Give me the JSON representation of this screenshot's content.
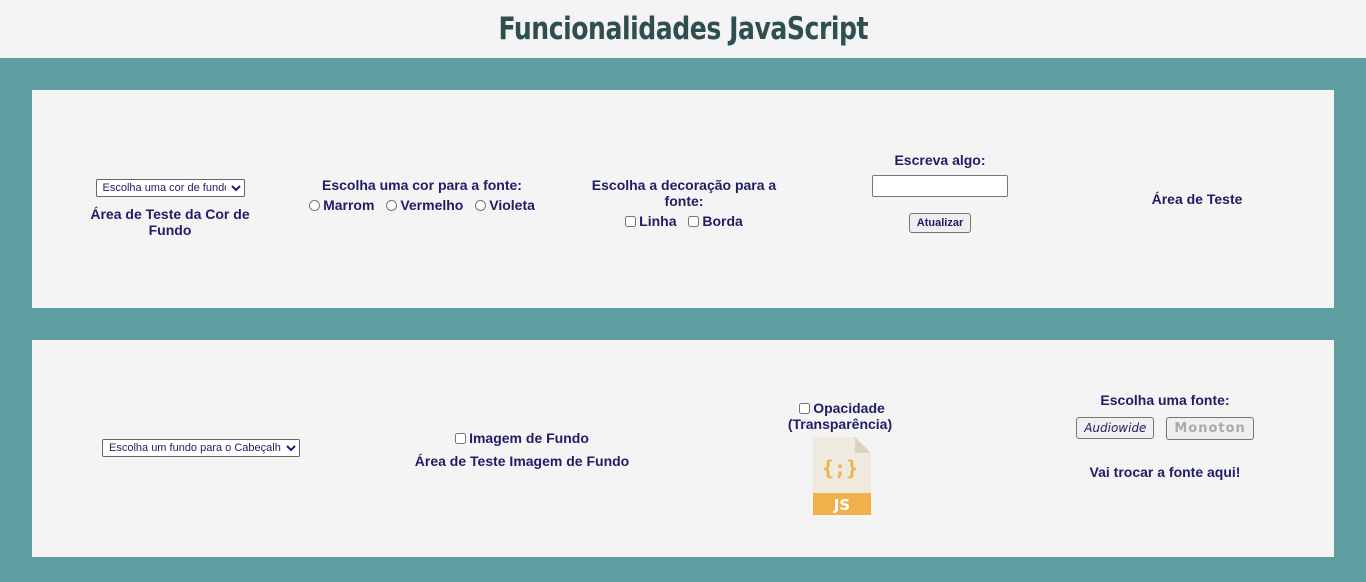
{
  "header": {
    "title": "Funcionalidades JavaScript"
  },
  "panel1": {
    "bg_select": {
      "selected": "Escolha uma cor de fundo"
    },
    "bg_test_label": "Área de Teste da Cor de Fundo",
    "font_color": {
      "heading": "Escolha uma cor para a fonte:",
      "options": [
        "Marrom",
        "Vermelho",
        "Violeta"
      ]
    },
    "decoration": {
      "heading": "Escolha a decoração para a fonte:",
      "options": [
        "Linha",
        "Borda"
      ]
    },
    "write": {
      "heading": "Escreva algo:",
      "input_value": "",
      "button_label": "Atualizar"
    },
    "test_area_label": "Área de Teste"
  },
  "panel2": {
    "header_select": {
      "selected": "Escolha um fundo para o Cabeçalho"
    },
    "bg_image": {
      "checkbox_label": "Imagem de Fundo",
      "test_label": "Área de Teste Imagem de Fundo"
    },
    "opacity": {
      "checkbox_label": "Opacidade (Transparência)",
      "icon_text": "JS",
      "icon_braces": "{;}"
    },
    "font_choice": {
      "heading": "Escolha uma fonte:",
      "buttons": [
        "Audiowide",
        "Monoton"
      ],
      "result_label": "Vai trocar a fonte aqui!"
    }
  },
  "colors": {
    "page_bg": "#5f9ea0",
    "panel_bg": "#f4f4f4",
    "text": "#1f1d66",
    "title": "#2f4f4f",
    "js_icon": "#f0b14a"
  }
}
